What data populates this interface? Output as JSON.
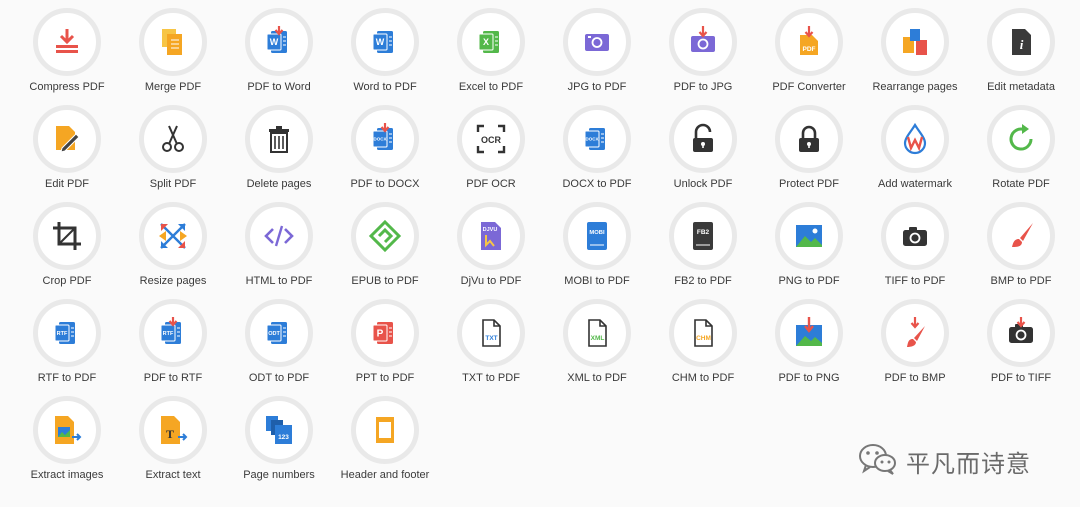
{
  "tools": [
    {
      "label": "Compress PDF",
      "icon": "compress-icon"
    },
    {
      "label": "Merge PDF",
      "icon": "merge-icon"
    },
    {
      "label": "PDF to Word",
      "icon": "pdf-to-word-icon"
    },
    {
      "label": "Word to PDF",
      "icon": "word-icon"
    },
    {
      "label": "Excel to PDF",
      "icon": "excel-icon"
    },
    {
      "label": "JPG to PDF",
      "icon": "camera-purple-icon"
    },
    {
      "label": "PDF to JPG",
      "icon": "pdf-to-jpg-icon"
    },
    {
      "label": "PDF Converter",
      "icon": "pdf-converter-icon"
    },
    {
      "label": "Rearrange pages",
      "icon": "rearrange-icon"
    },
    {
      "label": "Edit metadata",
      "icon": "metadata-icon"
    },
    {
      "label": "Edit PDF",
      "icon": "edit-pencil-icon"
    },
    {
      "label": "Split PDF",
      "icon": "scissors-icon"
    },
    {
      "label": "Delete pages",
      "icon": "trash-icon"
    },
    {
      "label": "PDF to DOCX",
      "icon": "pdf-to-docx-icon"
    },
    {
      "label": "PDF OCR",
      "icon": "ocr-icon"
    },
    {
      "label": "DOCX to PDF",
      "icon": "docx-icon"
    },
    {
      "label": "Unlock PDF",
      "icon": "unlock-icon"
    },
    {
      "label": "Protect PDF",
      "icon": "lock-icon"
    },
    {
      "label": "Add watermark",
      "icon": "watermark-drop-icon"
    },
    {
      "label": "Rotate PDF",
      "icon": "rotate-icon"
    },
    {
      "label": "Crop PDF",
      "icon": "crop-icon"
    },
    {
      "label": "Resize pages",
      "icon": "resize-arrows-icon"
    },
    {
      "label": "HTML to PDF",
      "icon": "code-icon"
    },
    {
      "label": "EPUB to PDF",
      "icon": "epub-icon"
    },
    {
      "label": "DjVu to PDF",
      "icon": "djvu-icon"
    },
    {
      "label": "MOBI to PDF",
      "icon": "mobi-icon"
    },
    {
      "label": "FB2 to PDF",
      "icon": "fb2-icon"
    },
    {
      "label": "PNG to PDF",
      "icon": "image-icon"
    },
    {
      "label": "TIFF to PDF",
      "icon": "camera-dark-icon"
    },
    {
      "label": "BMP to PDF",
      "icon": "brush-icon"
    },
    {
      "label": "RTF to PDF",
      "icon": "rtf-icon"
    },
    {
      "label": "PDF to RTF",
      "icon": "pdf-to-rtf-icon"
    },
    {
      "label": "ODT to PDF",
      "icon": "odt-icon"
    },
    {
      "label": "PPT to PDF",
      "icon": "ppt-icon"
    },
    {
      "label": "TXT to PDF",
      "icon": "txt-file-icon"
    },
    {
      "label": "XML to PDF",
      "icon": "xml-file-icon"
    },
    {
      "label": "CHM to PDF",
      "icon": "chm-file-icon"
    },
    {
      "label": "PDF to PNG",
      "icon": "pdf-to-png-icon"
    },
    {
      "label": "PDF to BMP",
      "icon": "pdf-to-bmp-icon"
    },
    {
      "label": "PDF to TIFF",
      "icon": "pdf-to-tiff-icon"
    },
    {
      "label": "Extract images",
      "icon": "extract-images-icon"
    },
    {
      "label": "Extract text",
      "icon": "extract-text-icon"
    },
    {
      "label": "Page numbers",
      "icon": "page-numbers-icon"
    },
    {
      "label": "Header and footer",
      "icon": "header-footer-icon"
    }
  ],
  "badges": {
    "word": "W",
    "excel": "X",
    "pdf": "PDF",
    "ocr": "OCR",
    "docx": "DOCX",
    "djvu": "DJVU",
    "mobi": "MOBI",
    "fb2": "FB2",
    "rtf": "RTF",
    "odt": "ODT",
    "ppt": "P",
    "txt": "TXT",
    "xml": "XML",
    "chm": "CHM",
    "text_t": "T",
    "page_num": "123"
  },
  "watermark": {
    "text": "平凡而诗意",
    "icon": "wechat-icon"
  },
  "colors": {
    "red": "#e8534a",
    "orange": "#f5a623",
    "blue": "#2d7dd8",
    "green": "#53b84a",
    "purple": "#7b68d6",
    "dark": "#333333",
    "bg": "#fafafa",
    "ring": "#e9e9e9"
  }
}
